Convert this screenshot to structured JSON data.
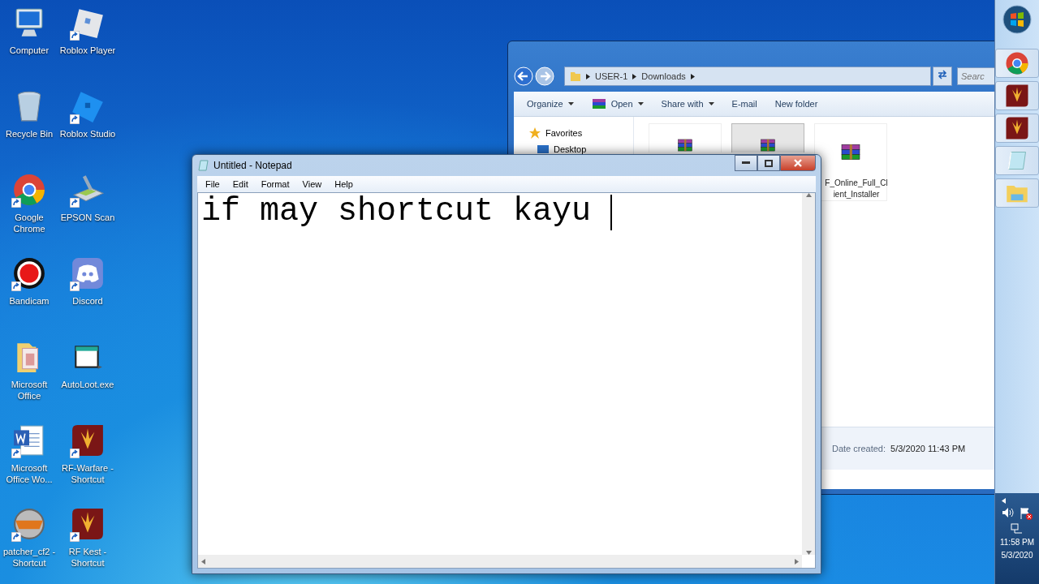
{
  "desktop_icons": [
    {
      "label": "Computer",
      "kind": "computer",
      "shortcut": false
    },
    {
      "label": "Roblox Player",
      "kind": "roblox",
      "shortcut": true
    },
    {
      "label": "Recycle Bin",
      "kind": "recycle",
      "shortcut": false
    },
    {
      "label": "Roblox Studio",
      "kind": "studio",
      "shortcut": true
    },
    {
      "label": "Google Chrome",
      "kind": "chrome",
      "shortcut": true
    },
    {
      "label": "EPSON Scan",
      "kind": "scanner",
      "shortcut": true
    },
    {
      "label": "Bandicam",
      "kind": "record",
      "shortcut": true
    },
    {
      "label": "Discord",
      "kind": "discord",
      "shortcut": true
    },
    {
      "label": "Microsoft Office",
      "kind": "folder",
      "shortcut": false
    },
    {
      "label": "AutoLoot.exe",
      "kind": "exe",
      "shortcut": false
    },
    {
      "label": "Microsoft Office Wo...",
      "kind": "word",
      "shortcut": true
    },
    {
      "label": "RF-Warfare - Shortcut",
      "kind": "rf",
      "shortcut": true
    },
    {
      "label": "patcher_cf2 - Shortcut",
      "kind": "cf",
      "shortcut": true
    },
    {
      "label": "RF Kest - Shortcut",
      "kind": "rf",
      "shortcut": true
    }
  ],
  "explorer": {
    "address": [
      "USER-1",
      "Downloads"
    ],
    "search": {
      "placeholder": "Searc"
    },
    "toolbar": [
      {
        "label": "Organize",
        "kind": "menu"
      },
      {
        "label": "Open",
        "kind": "open"
      },
      {
        "label": "Share with",
        "kind": "menu"
      },
      {
        "label": "E-mail",
        "kind": "plain"
      },
      {
        "label": "New folder",
        "kind": "plain"
      }
    ],
    "nav": [
      {
        "label": "Favorites",
        "kind": "star"
      },
      {
        "label": "Desktop",
        "kind": "desktop"
      }
    ],
    "files": [
      {
        "selected": false
      },
      {
        "selected": true
      },
      {
        "label": "F_Online_Full_Cl\nient_Installer",
        "selected": false
      }
    ],
    "details": {
      "label": "Date created:",
      "value": "5/3/2020 11:43 PM"
    }
  },
  "notepad": {
    "title": "Untitled - Notepad",
    "menu": [
      "File",
      "Edit",
      "Format",
      "View",
      "Help"
    ],
    "text": "if may shortcut kayu "
  },
  "taskbar": {
    "items": [
      {
        "kind": "chrome"
      },
      {
        "kind": "rf"
      },
      {
        "kind": "rf"
      },
      {
        "kind": "notepad"
      },
      {
        "kind": "explorer"
      }
    ],
    "clock": {
      "time": "11:58 PM",
      "date": "5/3/2020"
    }
  }
}
